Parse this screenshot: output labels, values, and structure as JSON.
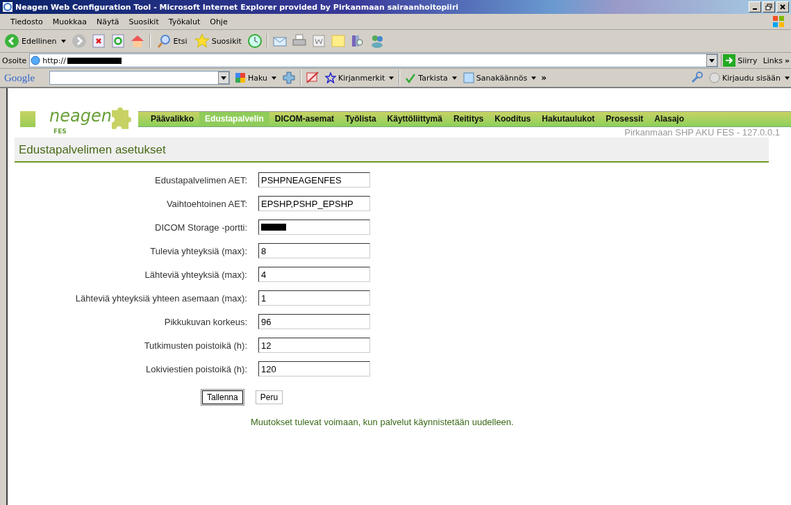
{
  "window": {
    "title": "Neagen Web Configuration Tool - Microsoft Internet Explorer provided by Pirkanmaan sairaanhoitopiiri"
  },
  "menu": [
    "Tiedosto",
    "Muokkaa",
    "Näytä",
    "Suosikit",
    "Työkalut",
    "Ohje"
  ],
  "toolbar": {
    "back": "Edellinen",
    "search": "Etsi",
    "favorites": "Suosikit"
  },
  "address": {
    "label": "Osoite",
    "value": "http://",
    "go": "Siirry",
    "links": "Links",
    "more": "»"
  },
  "google": {
    "logo": "Google",
    "search": "Haku",
    "bookmarks": "Kirjanmerkit",
    "check": "Tarkista",
    "translate": "Sanakäännös",
    "more": "»",
    "signin": "Kirjaudu sisään"
  },
  "app": {
    "logo": "neagen",
    "sublogo": "FES",
    "server": "Pirkanmaan SHP AKU FES - 127.0.0.1",
    "nav": [
      {
        "label": "Päävalikko",
        "selected": false
      },
      {
        "label": "Edustapalvelin",
        "selected": true
      },
      {
        "label": "DICOM-asemat",
        "selected": false
      },
      {
        "label": "Työlista",
        "selected": false
      },
      {
        "label": "Käyttöliittymä",
        "selected": false
      },
      {
        "label": "Reititys",
        "selected": false
      },
      {
        "label": "Kooditus",
        "selected": false
      },
      {
        "label": "Hakutaulukot",
        "selected": false
      },
      {
        "label": "Prosessit",
        "selected": false
      },
      {
        "label": "Alasajo",
        "selected": false
      }
    ]
  },
  "page": {
    "heading": "Edustapalvelimen asetukset",
    "fields": [
      {
        "label": "Edustapalvelimen AET:",
        "value": "PSHPNEAGENFES"
      },
      {
        "label": "Vaihtoehtoinen AET:",
        "value": "EPSHP,PSHP_EPSHP"
      },
      {
        "label": "DICOM Storage -portti:",
        "redacted": true
      },
      {
        "label": "Tulevia yhteyksiä (max):",
        "value": "8"
      },
      {
        "label": "Lähteviä yhteyksiä (max):",
        "value": "4"
      },
      {
        "label": "Lähteviä yhteyksiä yhteen asemaan (max):",
        "value": "1"
      },
      {
        "label": "Pikkukuvan korkeus:",
        "value": "96"
      },
      {
        "label": "Tutkimusten poistoikä (h):",
        "value": "12"
      },
      {
        "label": "Lokiviestien poistoikä (h):",
        "value": "120"
      }
    ],
    "buttons": [
      {
        "label": "Tallenna",
        "selected": true
      },
      {
        "label": "Peru",
        "selected": false
      }
    ],
    "note": "Muutokset tulevat voimaan, kun palvelut käynnistetään uudelleen."
  }
}
